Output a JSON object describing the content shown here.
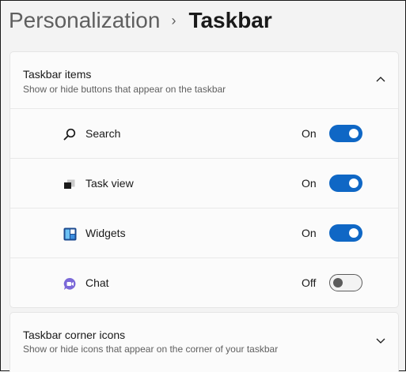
{
  "breadcrumb": {
    "parent": "Personalization",
    "separator": "›",
    "current": "Taskbar"
  },
  "taskbar_items": {
    "title": "Taskbar items",
    "subtitle": "Show or hide buttons that appear on the taskbar",
    "expanded": true,
    "rows": [
      {
        "label": "Search",
        "state": "On",
        "on": true,
        "icon": "search-icon"
      },
      {
        "label": "Task view",
        "state": "On",
        "on": true,
        "icon": "task-view-icon"
      },
      {
        "label": "Widgets",
        "state": "On",
        "on": true,
        "icon": "widgets-icon"
      },
      {
        "label": "Chat",
        "state": "Off",
        "on": false,
        "icon": "chat-icon"
      }
    ]
  },
  "corner_icons": {
    "title": "Taskbar corner icons",
    "subtitle": "Show or hide icons that appear on the corner of your taskbar",
    "expanded": false
  },
  "colors": {
    "accent": "#0f67c5",
    "background": "#f3f3f3",
    "card": "#fbfbfb"
  }
}
